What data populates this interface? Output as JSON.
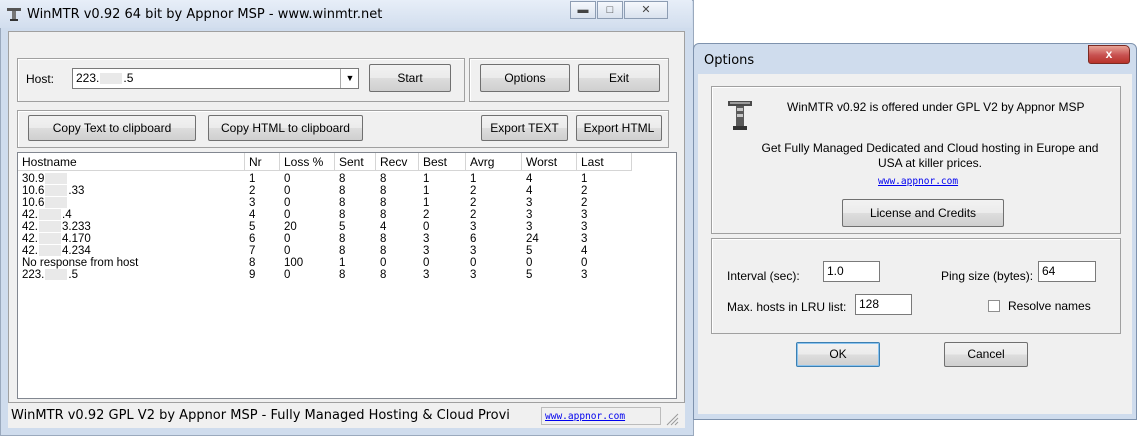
{
  "main": {
    "title": "WinMTR v0.92 64 bit by Appnor MSP - www.winmtr.net",
    "host_label": "Host:",
    "host_value_prefix": "223.",
    "host_value_suffix": ".5",
    "start_label": "Start",
    "options_label": "Options",
    "exit_label": "Exit",
    "copy_text_label": "Copy Text to clipboard",
    "copy_html_label": "Copy HTML to clipboard",
    "export_text_label": "Export TEXT",
    "export_html_label": "Export HTML",
    "columns": [
      "Hostname",
      "Nr",
      "Loss %",
      "Sent",
      "Recv",
      "Best",
      "Avrg",
      "Worst",
      "Last"
    ],
    "rows": [
      {
        "host_a": "30.9",
        "host_b": "",
        "nr": "1",
        "loss": "0",
        "sent": "8",
        "recv": "8",
        "best": "1",
        "avrg": "1",
        "worst": "4",
        "last": "1"
      },
      {
        "host_a": "10.6",
        "host_b": ".33",
        "nr": "2",
        "loss": "0",
        "sent": "8",
        "recv": "8",
        "best": "1",
        "avrg": "2",
        "worst": "4",
        "last": "2"
      },
      {
        "host_a": "10.6",
        "host_b": "",
        "nr": "3",
        "loss": "0",
        "sent": "8",
        "recv": "8",
        "best": "1",
        "avrg": "2",
        "worst": "3",
        "last": "2"
      },
      {
        "host_a": "42.",
        "host_b": ".4",
        "nr": "4",
        "loss": "0",
        "sent": "8",
        "recv": "8",
        "best": "2",
        "avrg": "2",
        "worst": "3",
        "last": "3"
      },
      {
        "host_a": "42.",
        "host_b": "3.233",
        "nr": "5",
        "loss": "20",
        "sent": "5",
        "recv": "4",
        "best": "0",
        "avrg": "3",
        "worst": "3",
        "last": "3"
      },
      {
        "host_a": "42.",
        "host_b": "4.170",
        "nr": "6",
        "loss": "0",
        "sent": "8",
        "recv": "8",
        "best": "3",
        "avrg": "6",
        "worst": "24",
        "last": "3"
      },
      {
        "host_a": "42.",
        "host_b": "4.234",
        "nr": "7",
        "loss": "0",
        "sent": "8",
        "recv": "8",
        "best": "3",
        "avrg": "3",
        "worst": "5",
        "last": "4"
      },
      {
        "host_a": "No response from host",
        "host_b": "",
        "nr": "8",
        "loss": "100",
        "sent": "1",
        "recv": "0",
        "best": "0",
        "avrg": "0",
        "worst": "0",
        "last": "0"
      },
      {
        "host_a": "223.",
        "host_b": ".5",
        "nr": "9",
        "loss": "0",
        "sent": "8",
        "recv": "8",
        "best": "3",
        "avrg": "3",
        "worst": "5",
        "last": "3"
      }
    ],
    "status_text": "WinMTR v0.92 GPL V2 by Appnor MSP - Fully Managed Hosting & Cloud Provi",
    "status_link": "www.appnor.com"
  },
  "options": {
    "title": "Options",
    "close_label": "x",
    "gpl_text": "WinMTR v0.92 is offered under GPL V2 by Appnor MSP",
    "promo_text": "Get Fully Managed Dedicated and Cloud hosting in Europe and USA at killer prices.",
    "link": "www.appnor.com",
    "license_label": "License and Credits",
    "interval_label": "Interval (sec):",
    "interval_value": "1.0",
    "ping_size_label": "Ping size (bytes):",
    "ping_size_value": "64",
    "max_hosts_label": "Max. hosts in LRU list:",
    "max_hosts_value": "128",
    "resolve_label": "Resolve names",
    "ok_label": "OK",
    "cancel_label": "Cancel"
  },
  "colors": {
    "titlebar": "#d2deee",
    "client": "#f0f0f0",
    "link": "#0000ee",
    "close_button": "#c75050"
  }
}
